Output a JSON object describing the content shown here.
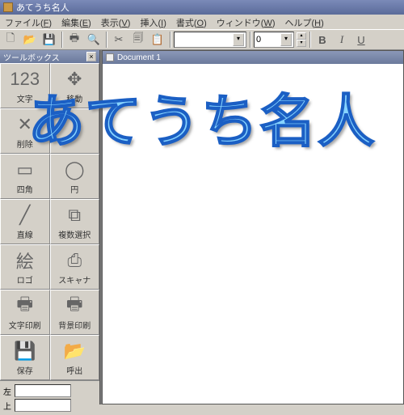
{
  "app": {
    "title": "あてうち名人"
  },
  "menu": {
    "file": "ファイル",
    "file_u": "F",
    "edit": "編集",
    "edit_u": "E",
    "view": "表示",
    "view_u": "V",
    "insert": "挿入",
    "insert_u": "I",
    "format": "書式",
    "format_u": "O",
    "window": "ウィンドウ",
    "window_u": "W",
    "help": "ヘルプ",
    "help_u": "H"
  },
  "toolbar": {
    "font_combo": "",
    "size_value": "0",
    "bold": "B",
    "italic": "I",
    "underline": "U"
  },
  "toolbox": {
    "title": "ツールボックス",
    "items": [
      {
        "label": "文字",
        "icon": "123"
      },
      {
        "label": "移動",
        "icon": "✥"
      },
      {
        "label": "削除",
        "icon": "✕"
      },
      {
        "label": "",
        "icon": ""
      },
      {
        "label": "四角",
        "icon": "▭"
      },
      {
        "label": "円",
        "icon": "◯"
      },
      {
        "label": "直線",
        "icon": "╱"
      },
      {
        "label": "複数選択",
        "icon": "⧉"
      },
      {
        "label": "ロゴ",
        "icon": "絵"
      },
      {
        "label": "スキャナ",
        "icon": "⎙"
      },
      {
        "label": "文字印刷",
        "icon": "🖶"
      },
      {
        "label": "背景印刷",
        "icon": "🖶"
      },
      {
        "label": "保存",
        "icon": "💾"
      },
      {
        "label": "呼出",
        "icon": "📂"
      }
    ]
  },
  "coords": {
    "left_label": "左",
    "top_label": "上"
  },
  "document": {
    "title": "Document 1"
  },
  "overlay_text": "あてうち名人"
}
